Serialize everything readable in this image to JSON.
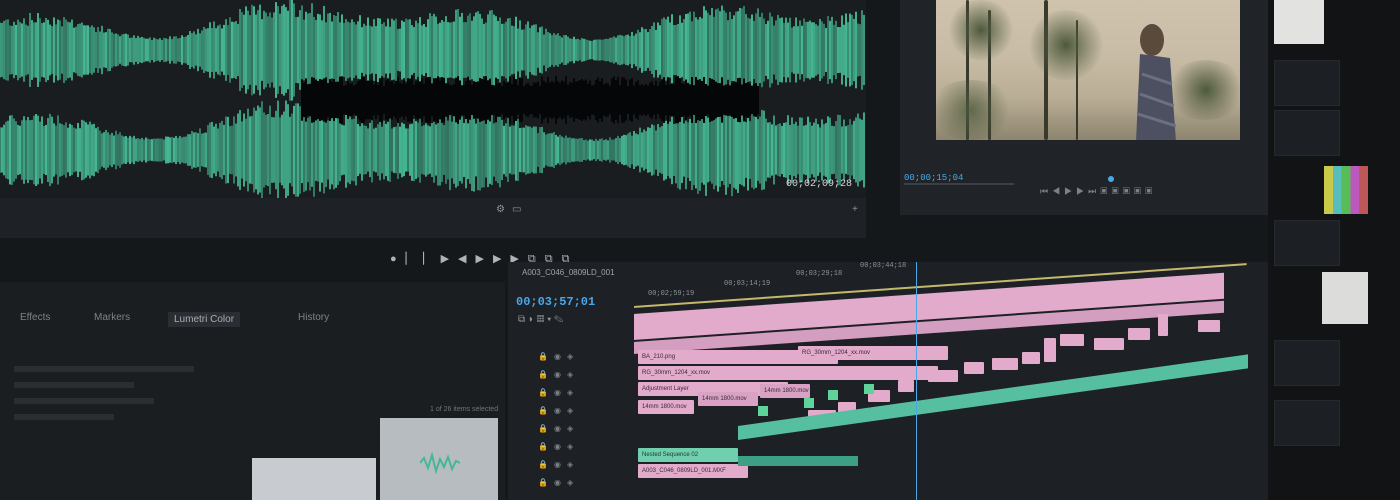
{
  "source_monitor": {
    "timecode": "00;02;09;28",
    "waveform_color": "#46b893"
  },
  "program_monitor": {
    "timecode": "00;00;15;04",
    "accent": "#4aa7e8"
  },
  "timeline": {
    "sequence_name": "A003_C046_0809LD_001",
    "current_timecode": "00;03;57;01",
    "ruler_labels": [
      "00;02;59;19",
      "00;03;14;19",
      "00;03;29;18",
      "00;03;44;18"
    ],
    "clips": [
      {
        "label": "BA_210.png",
        "color": "pink"
      },
      {
        "label": "RG_30mm_1204_xx.mov",
        "color": "pink"
      },
      {
        "label": "Adjustment Layer",
        "color": "pink"
      },
      {
        "label": "14mm 1800.mov",
        "color": "pink"
      },
      {
        "label": "14mm 1800.mov",
        "color": "pink"
      },
      {
        "label": "14mm 1800.mov",
        "color": "pink"
      },
      {
        "label": "Nested Sequence 02",
        "color": "green"
      },
      {
        "label": "A003_C046_0809LD_001.MXF",
        "color": "pink"
      },
      {
        "label": "RG_30mm_1204_xx.mov",
        "color": "pink"
      }
    ]
  },
  "project_panel": {
    "tabs": [
      "Effects",
      "Markers",
      "Lumetri Color",
      "History"
    ],
    "selection_text": "1 of 26 items selected"
  },
  "colors": {
    "clip_pink": "#e2aacb",
    "clip_green": "#6fcfae",
    "timecode_blue": "#4aa7e8",
    "background": "#15181b"
  }
}
